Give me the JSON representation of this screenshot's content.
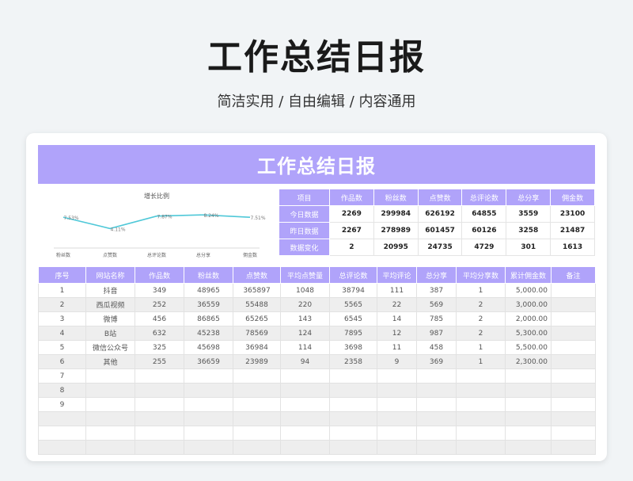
{
  "page": {
    "title": "工作总结日报",
    "subtitle": "简洁实用 / 自由编辑 / 内容通用"
  },
  "banner_title": "工作总结日报",
  "colors": {
    "accent": "#b0a3fa",
    "line": "#4fc8d8"
  },
  "chart_data": {
    "type": "line",
    "title": "增长比例",
    "categories": [
      "粉丝数",
      "点赞数",
      "总评论数",
      "总分享",
      "佣金数"
    ],
    "values": [
      7.53,
      4.11,
      7.87,
      8.24,
      7.51
    ],
    "data_labels": [
      "7.53%",
      "4.11%",
      "7.87%",
      "8.24%",
      "7.51%"
    ],
    "xlabel": "",
    "ylabel": "",
    "grid": false
  },
  "summary": {
    "headers": [
      "项目",
      "作品数",
      "粉丝数",
      "点赞数",
      "总评论数",
      "总分享",
      "佣金数"
    ],
    "rows": [
      [
        "今日数据",
        "2269",
        "299984",
        "626192",
        "64855",
        "3559",
        "23100"
      ],
      [
        "昨日数据",
        "2267",
        "278989",
        "601457",
        "60126",
        "3258",
        "21487"
      ],
      [
        "数据变化",
        "2",
        "20995",
        "24735",
        "4729",
        "301",
        "1613"
      ]
    ]
  },
  "table": {
    "headers": [
      "序号",
      "网站名称",
      "作品数",
      "粉丝数",
      "点赞数",
      "平均点赞量",
      "总评论数",
      "平均评论",
      "总分享",
      "平均分享数",
      "累计佣金数",
      "备注"
    ],
    "rows": [
      [
        "1",
        "抖音",
        "349",
        "48965",
        "365897",
        "1048",
        "38794",
        "111",
        "387",
        "1",
        "5,000.00",
        ""
      ],
      [
        "2",
        "西瓜视频",
        "252",
        "36559",
        "55488",
        "220",
        "5565",
        "22",
        "569",
        "2",
        "3,000.00",
        ""
      ],
      [
        "3",
        "微博",
        "456",
        "86865",
        "65265",
        "143",
        "6545",
        "14",
        "785",
        "2",
        "2,000.00",
        ""
      ],
      [
        "4",
        "B站",
        "632",
        "45238",
        "78569",
        "124",
        "7895",
        "12",
        "987",
        "2",
        "5,300.00",
        ""
      ],
      [
        "5",
        "微信公众号",
        "325",
        "45698",
        "36984",
        "114",
        "3698",
        "11",
        "458",
        "1",
        "5,500.00",
        ""
      ],
      [
        "6",
        "其他",
        "255",
        "36659",
        "23989",
        "94",
        "2358",
        "9",
        "369",
        "1",
        "2,300.00",
        ""
      ],
      [
        "7",
        "",
        "",
        "",
        "",
        "",
        "",
        "",
        "",
        "",
        "",
        ""
      ],
      [
        "8",
        "",
        "",
        "",
        "",
        "",
        "",
        "",
        "",
        "",
        "",
        ""
      ],
      [
        "9",
        "",
        "",
        "",
        "",
        "",
        "",
        "",
        "",
        "",
        "",
        ""
      ],
      [
        "",
        "",
        "",
        "",
        "",
        "",
        "",
        "",
        "",
        "",
        "",
        ""
      ],
      [
        "",
        "",
        "",
        "",
        "",
        "",
        "",
        "",
        "",
        "",
        "",
        ""
      ],
      [
        "",
        "",
        "",
        "",
        "",
        "",
        "",
        "",
        "",
        "",
        "",
        ""
      ]
    ]
  }
}
